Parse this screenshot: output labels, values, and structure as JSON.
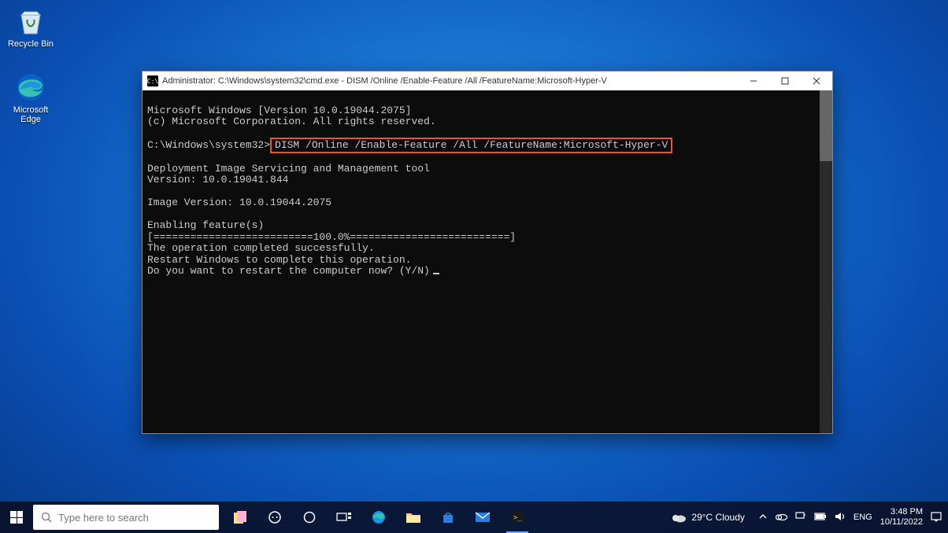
{
  "desktop": {
    "icons": [
      {
        "name": "recycle-bin",
        "label": "Recycle Bin"
      },
      {
        "name": "edge",
        "label": "Microsoft\nEdge"
      }
    ]
  },
  "window": {
    "title": "Administrator: C:\\Windows\\system32\\cmd.exe - DISM  /Online /Enable-Feature /All /FeatureName:Microsoft-Hyper-V",
    "prompt_path": "C:\\Windows\\system32>",
    "highlighted_command": "DISM /Online /Enable-Feature /All /FeatureName:Microsoft-Hyper-V",
    "lines": {
      "l1": "Microsoft Windows [Version 10.0.19044.2075]",
      "l2": "(c) Microsoft Corporation. All rights reserved.",
      "blank1": "",
      "blank2": "",
      "l5": "Deployment Image Servicing and Management tool",
      "l6": "Version: 10.0.19041.844",
      "blank3": "",
      "l8": "Image Version: 10.0.19044.2075",
      "blank4": "",
      "l10": "Enabling feature(s)",
      "l11": "[==========================100.0%==========================]",
      "l12": "The operation completed successfully.",
      "l13": "Restart Windows to complete this operation.",
      "l14": "Do you want to restart the computer now? (Y/N)"
    }
  },
  "taskbar": {
    "search_placeholder": "Type here to search",
    "weather": "29°C Cloudy",
    "time": "3:48 PM",
    "date": "10/11/2022"
  }
}
